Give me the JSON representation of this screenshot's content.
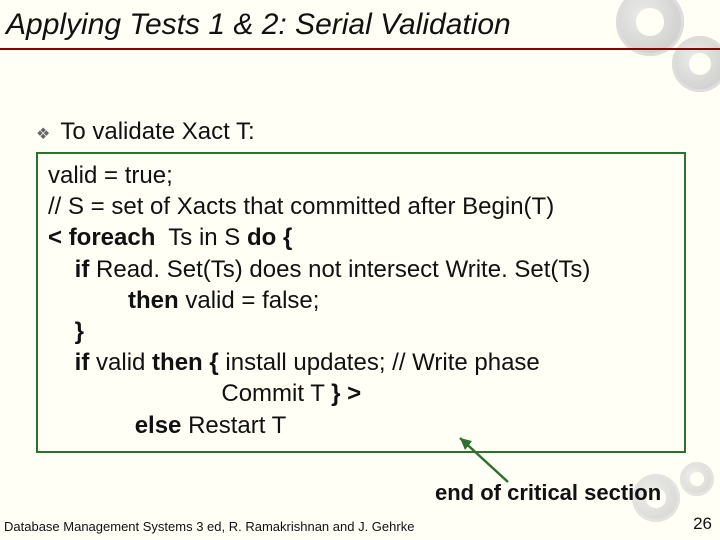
{
  "title": "Applying Tests 1 & 2: Serial Validation",
  "bullet": "To validate Xact T:",
  "code": {
    "l1": "valid = true;",
    "l2": "// S = set of Xacts that committed after Begin(T)",
    "l3_open": "<",
    "l3_kw1": "foreach",
    "l3_mid": "  Ts in S ",
    "l3_kw2": "do {",
    "l4_pre": "    ",
    "l4_kw": "if",
    "l4_rest": " Read. Set(Ts) does not intersect Write. Set(Ts)",
    "l5_pre": "            ",
    "l5_kw": "then",
    "l5_rest": " valid = false;",
    "l6_pre": "    ",
    "l6_kw": "}",
    "l7_pre": "    ",
    "l7_kw1": "if",
    "l7_mid": " valid ",
    "l7_kw2": "then {",
    "l7_rest": " install updates; // Write phase",
    "l8_pre": "                          Commit T ",
    "l8_kw": "} >",
    "l9_pre": "             ",
    "l9_kw": "else",
    "l9_rest": " Restart T"
  },
  "annotation": "end of critical section",
  "footer_left": "Database Management Systems 3 ed,  R. Ramakrishnan and J. Gehrke",
  "footer_right": "26"
}
